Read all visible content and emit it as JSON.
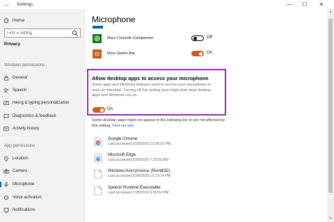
{
  "window": {
    "title": "Settings",
    "back_glyph": "←",
    "min_glyph": "—",
    "max_glyph": "☐",
    "close_glyph": "✕"
  },
  "nav": {
    "home": "Home",
    "search_placeholder": "Find a setting",
    "section": "Privacy",
    "windows_permissions": "Windows permissions",
    "app_permissions": "App permissions",
    "windows_items": [
      {
        "label": "General",
        "icon": "lock-icon"
      },
      {
        "label": "Speech",
        "icon": "speech-icon"
      },
      {
        "label": "Inking & typing personalization",
        "icon": "inking-icon"
      },
      {
        "label": "Diagnostics & feedback",
        "icon": "diagnostics-icon"
      },
      {
        "label": "Activity history",
        "icon": "history-icon"
      }
    ],
    "app_items": [
      {
        "label": "Location",
        "icon": "location-icon"
      },
      {
        "label": "Camera",
        "icon": "camera-icon"
      },
      {
        "label": "Microphone",
        "icon": "microphone-icon",
        "active": true
      },
      {
        "label": "Voice activation",
        "icon": "voice-icon"
      },
      {
        "label": "Notifications",
        "icon": "notifications-icon"
      }
    ]
  },
  "main": {
    "title": "Microphone",
    "apps": [
      {
        "name": "Xbox Console Companion",
        "state": "Off",
        "tile_color": "#107c10",
        "icon": "xbox-companion-icon"
      },
      {
        "name": "Xbox Game Bar",
        "state": "On",
        "tile_color": "#d0591f",
        "icon": "game-bar-icon"
      }
    ],
    "desktop_section": {
      "title": "Allow desktop apps to access your microphone",
      "description": "Some apps and Windows features need to access your microphone to work as intended. Turning off this setting here might limit what desktop apps and Windows can do.",
      "state": "On"
    },
    "note": "Some desktop apps might not appear in the following list or are not affected by this setting.",
    "note_link": "Find out why",
    "recent": [
      {
        "name": "Google Chrome",
        "time": "Last accessed 5/28/2020 12:08:53 PM",
        "icon": "chrome-icon"
      },
      {
        "name": "Microsoft Edge",
        "time": "Last accessed 5/28/2020 7:23:53 AM",
        "icon": "edge-icon"
      },
      {
        "name": "Windows host process (Rundll32)",
        "time": "Last accessed 5/28/2020 12:13:14 PM",
        "icon": "file-icon"
      },
      {
        "name": "Speech Runtime Executable",
        "time": "Last accessed 7/28/2019 6:59:52 PM",
        "icon": "file-icon"
      }
    ]
  },
  "colors": {
    "accent": "#0067b8",
    "toggle_on": "#d0591f",
    "highlight": "#9b27b0",
    "nav_bg": "#f2f2f2"
  }
}
